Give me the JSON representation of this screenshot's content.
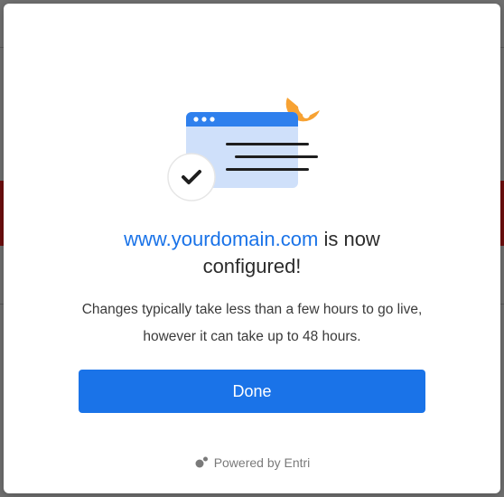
{
  "dialog": {
    "domain": "www.yourdomain.com",
    "status_line_1": " is now",
    "status_line_2": "configured!",
    "description": "Changes typically take less than a few hours to go live, however it can take up to 48 hours.",
    "done_label": "Done",
    "powered_by": "Powered by Entri"
  },
  "colors": {
    "accent": "#1a73e8",
    "illustration_panel": "#cfe0fa",
    "illustration_header": "#2f80ed",
    "illustration_orange": "#f7a233"
  },
  "icons": [
    "browser-window-illustration",
    "checkmark-icon",
    "entri-logo-icon"
  ]
}
